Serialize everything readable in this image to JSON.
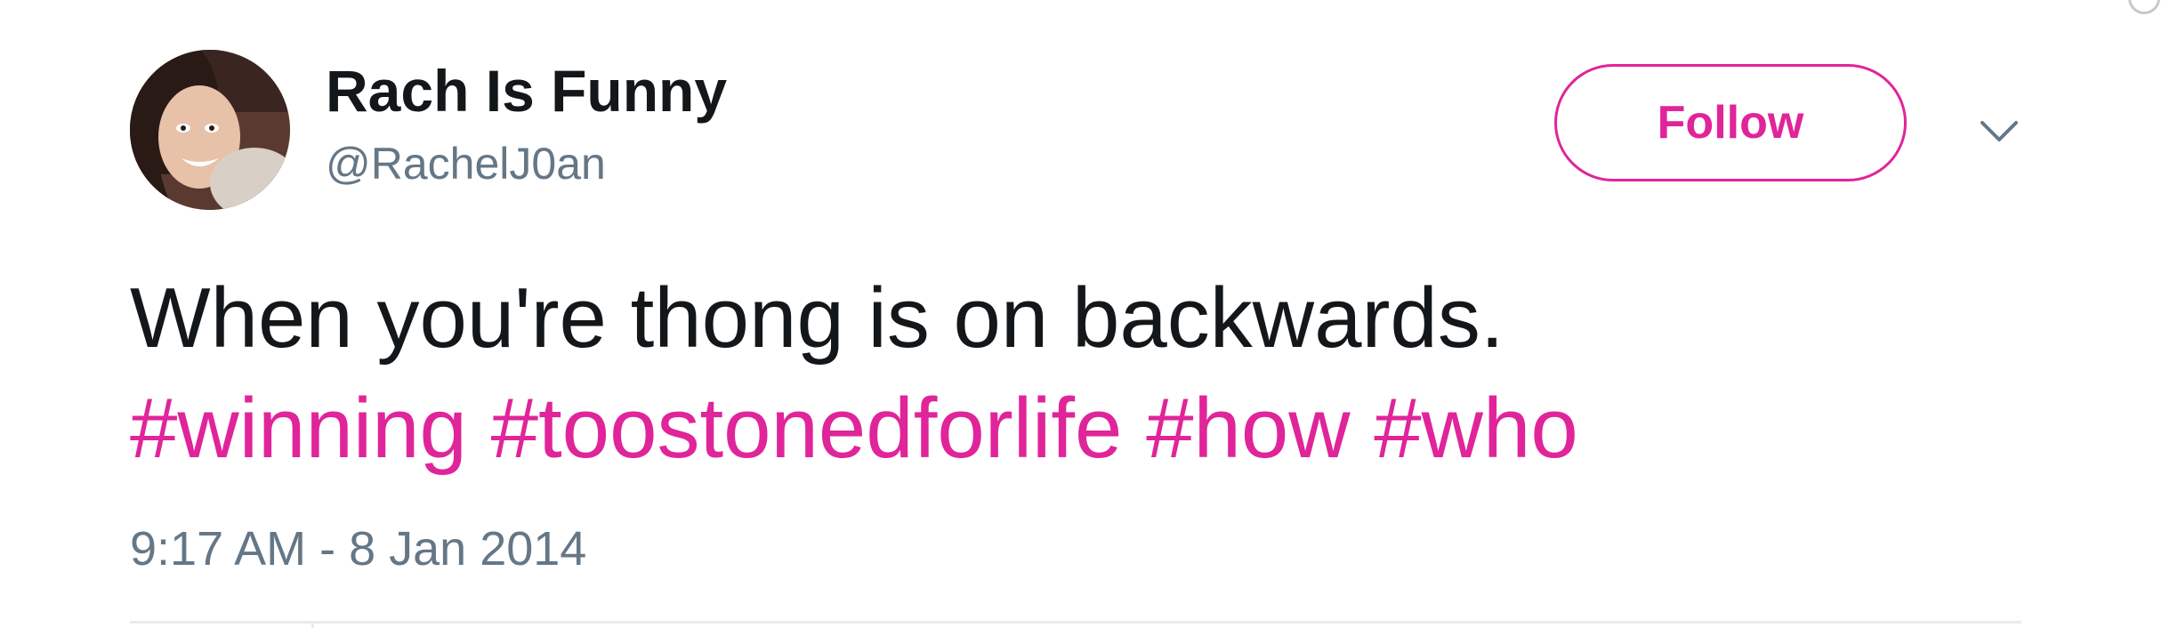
{
  "tweet": {
    "author": {
      "display_name": "Rach Is Funny",
      "handle": "@RachelJ0an",
      "avatar_icon": "profile-photo"
    },
    "follow_label": "Follow",
    "menu_icon": "chevron-down-icon",
    "text": "When you're thong is on backwards.",
    "hashtags": [
      "#winning",
      "#toostonedforlife",
      "#how",
      "#who"
    ],
    "timestamp": "9:17 AM - 8 Jan 2014"
  },
  "colors": {
    "accent": "#e0249a",
    "text": "#14171a",
    "secondary": "#657786",
    "divider": "#e6ecf0"
  }
}
